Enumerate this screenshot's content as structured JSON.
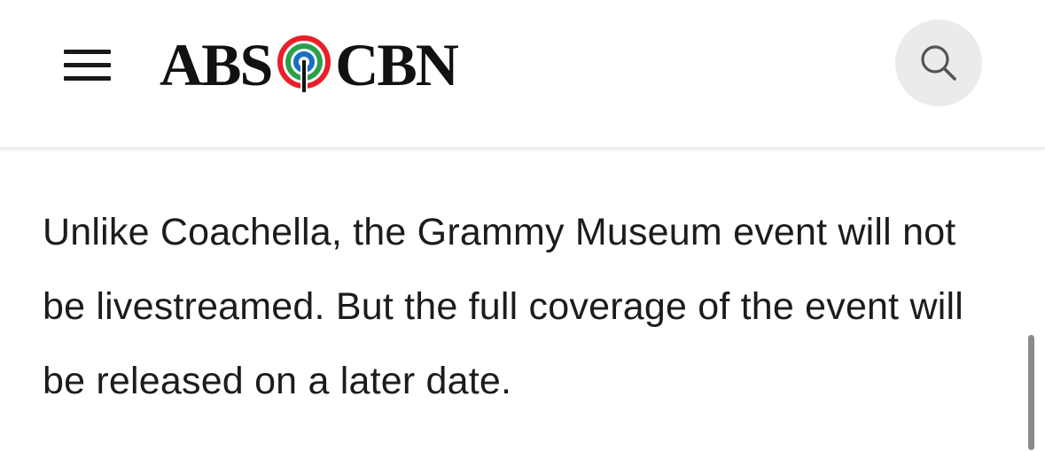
{
  "header": {
    "logo": {
      "left_text": "ABS",
      "right_text": "CBN",
      "mark_colors": [
        "#e8202a",
        "#2aa04a",
        "#1a6fc4"
      ]
    },
    "menu_icon": "hamburger-menu-icon",
    "search_icon": "search-icon"
  },
  "article": {
    "paragraph": "Unlike Coachella, the Grammy Museum event will not be livestreamed. But the full coverage of the event will be released on a later date."
  },
  "colors": {
    "text": "#1c1c1c",
    "search_bg": "#ebebeb",
    "scrollbar": "#8a8a8a"
  }
}
